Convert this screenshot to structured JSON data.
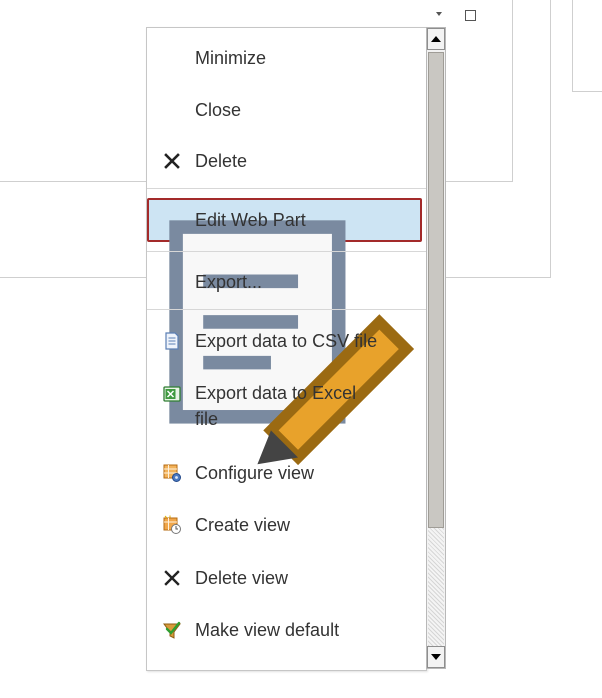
{
  "menu": {
    "items": [
      {
        "label": "Minimize",
        "icon": ""
      },
      {
        "label": "Close",
        "icon": ""
      },
      {
        "label": "Delete",
        "icon": "x-icon"
      },
      {
        "label": "Edit Web Part",
        "icon": "edit-web-part-icon",
        "highlighted": true
      },
      {
        "label": "Export...",
        "icon": ""
      },
      {
        "label": "Export data to CSV file",
        "icon": "csv-document-icon"
      },
      {
        "label": "Export data to Excel",
        "label2": "file",
        "icon": "excel-icon"
      },
      {
        "label": "Configure view",
        "icon": "configure-view-icon"
      },
      {
        "label": "Create view",
        "icon": "create-view-icon"
      },
      {
        "label": "Delete view",
        "icon": "x-icon"
      },
      {
        "label": "Make view default",
        "icon": "make-default-icon"
      }
    ]
  },
  "colors": {
    "highlight_bg": "#cde4f3",
    "highlight_border": "#a32a2a",
    "text": "#333333"
  }
}
